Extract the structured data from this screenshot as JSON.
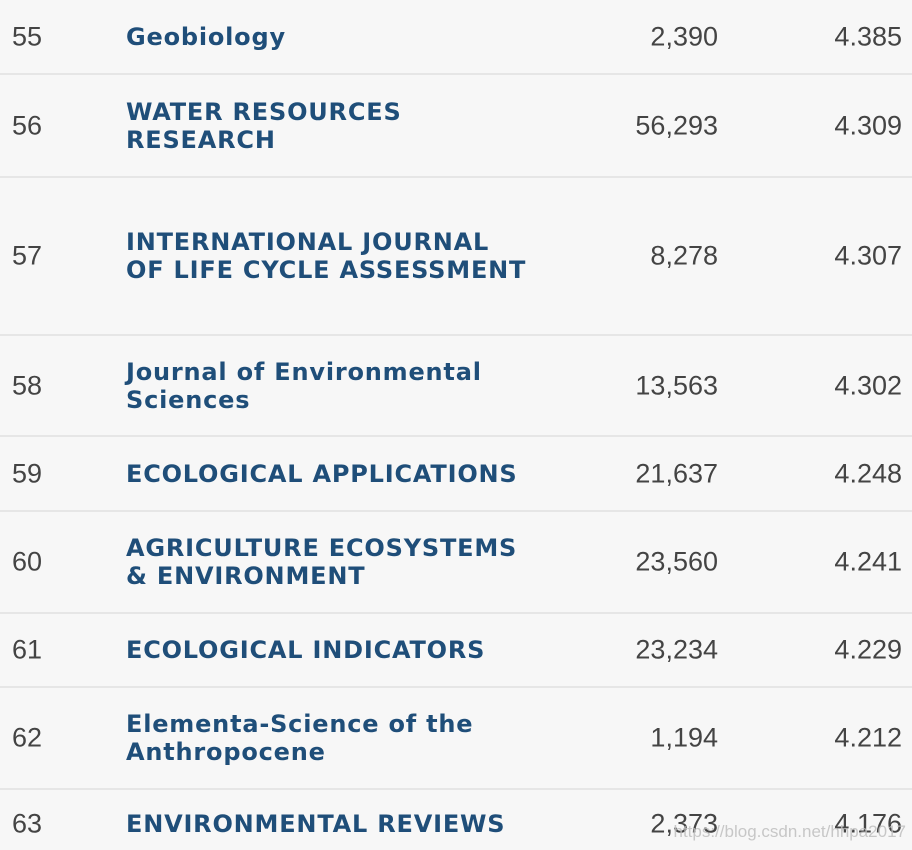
{
  "rows": [
    {
      "rank": "55",
      "title": "Geobiology",
      "total_cites": "2,390",
      "impact_factor": "4.385"
    },
    {
      "rank": "56",
      "title": "WATER RESOURCES RESEARCH",
      "total_cites": "56,293",
      "impact_factor": "4.309"
    },
    {
      "rank": "57",
      "title": "INTERNATIONAL JOURNAL OF LIFE CYCLE ASSESSMENT",
      "total_cites": "8,278",
      "impact_factor": "4.307"
    },
    {
      "rank": "58",
      "title": "Journal of Environmental Sciences",
      "total_cites": "13,563",
      "impact_factor": "4.302"
    },
    {
      "rank": "59",
      "title": "ECOLOGICAL APPLICATIONS",
      "total_cites": "21,637",
      "impact_factor": "4.248"
    },
    {
      "rank": "60",
      "title": "AGRICULTURE ECOSYSTEMS & ENVIRONMENT",
      "total_cites": "23,560",
      "impact_factor": "4.241"
    },
    {
      "rank": "61",
      "title": "ECOLOGICAL INDICATORS",
      "total_cites": "23,234",
      "impact_factor": "4.229"
    },
    {
      "rank": "62",
      "title": "Elementa-Science of the Anthropocene",
      "total_cites": "1,194",
      "impact_factor": "4.212"
    },
    {
      "rank": "63",
      "title": "ENVIRONMENTAL REVIEWS",
      "total_cites": "2,373",
      "impact_factor": "4.176"
    }
  ],
  "watermark": "https://blog.csdn.net/hhpa2017"
}
